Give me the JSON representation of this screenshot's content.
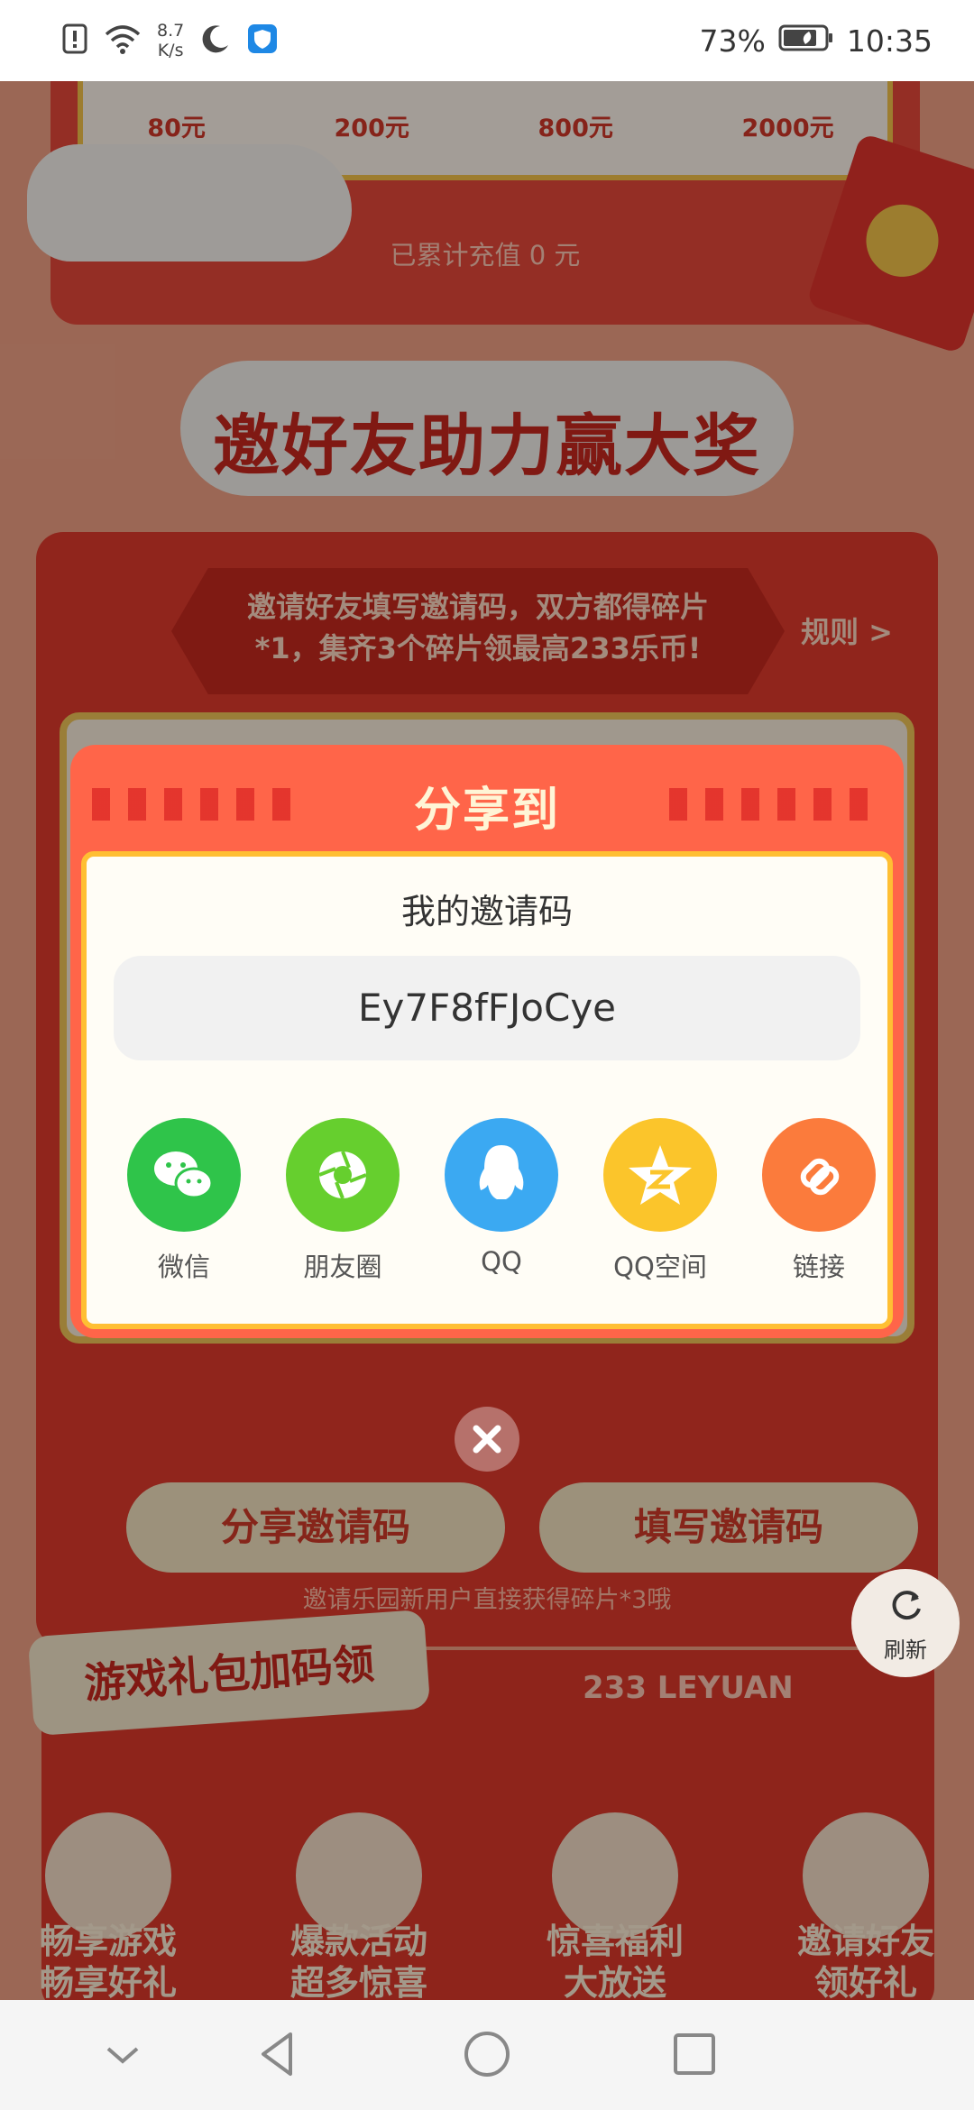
{
  "status_bar": {
    "net_speed_value": "8.7",
    "net_speed_unit": "K/s",
    "battery": "73%",
    "time": "10:35"
  },
  "recharge": {
    "amounts": [
      "80元",
      "200元",
      "800元",
      "2000元"
    ],
    "accumulated": "已累计充值 0 元"
  },
  "invite_section": {
    "title": "邀好友助力赢大奖",
    "banner_line1": "邀请好友填写邀请码，双方都得碎片",
    "banner_line2": "*1，集齐3个碎片领最高233乐币!",
    "rules_link": "规则 >",
    "share_code_button": "分享邀请码",
    "enter_code_button": "填写邀请码",
    "note": "邀请乐园新用户直接获得碎片*3哦"
  },
  "refresh": {
    "label": "刷新"
  },
  "gift_section": {
    "title": "游戏礼包加码领",
    "brand": "233 LEYUAN",
    "features": [
      {
        "line1": "畅享游戏",
        "line2": "畅享好礼"
      },
      {
        "line1": "爆款活动",
        "line2": "超多惊喜"
      },
      {
        "line1": "惊喜福利",
        "line2": "大放送"
      },
      {
        "line1": "邀请好友",
        "line2": "领好礼"
      }
    ]
  },
  "share_dialog": {
    "title": "分享到",
    "code_label": "我的邀请码",
    "code": "Ey7F8fFJoCye",
    "options": [
      {
        "label": "微信",
        "icon": "wechat-icon",
        "color": "#2fc44a"
      },
      {
        "label": "朋友圈",
        "icon": "moments-icon",
        "color": "#66cf2e"
      },
      {
        "label": "QQ",
        "icon": "qq-icon",
        "color": "#3ba9f2"
      },
      {
        "label": "QQ空间",
        "icon": "qzone-icon",
        "color": "#fbc52b"
      },
      {
        "label": "链接",
        "icon": "link-icon",
        "color": "#fb7b3c"
      }
    ]
  }
}
